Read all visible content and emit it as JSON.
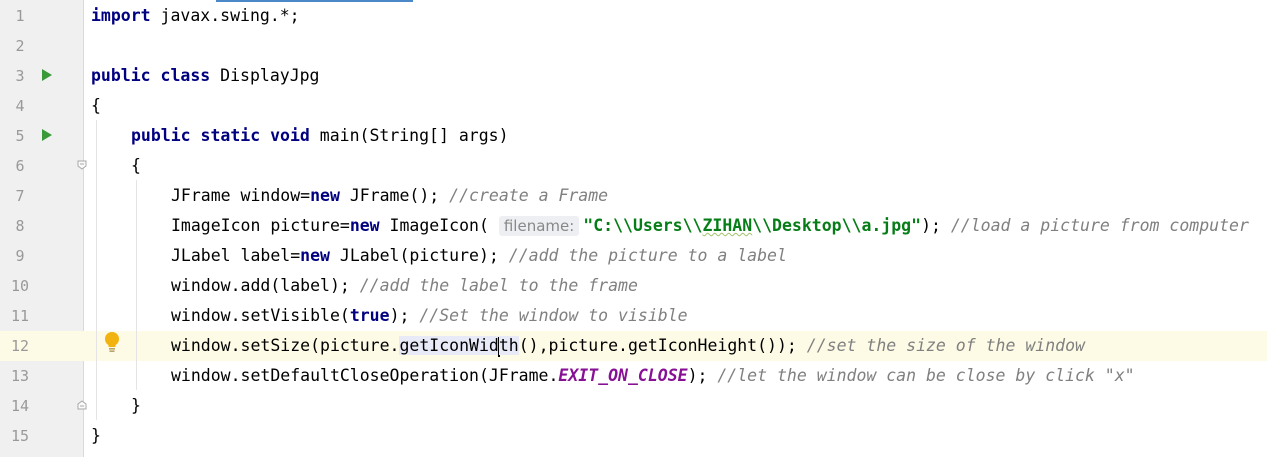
{
  "tokens": {
    "brace_open": "{",
    "brace_close": "}",
    "kw_import": "import",
    "import_rest": " javax.swing.*;",
    "kw_public": "public",
    "kw_class": "class",
    "class_name": " DisplayJpg",
    "kw_static": "static",
    "kw_void": "void",
    "main_sig": " main(String[] args)",
    "l7_a": "JFrame window=",
    "kw_new": "new",
    "l7_b": " JFrame(); ",
    "l7_c": "//create a Frame",
    "l8_a": "ImageIcon picture=",
    "l8_b": " ImageIcon(",
    "l8_hint": "filename:",
    "l8_str1": "\"C:\\\\Users\\\\",
    "l8_str_warn": "ZIHAN",
    "l8_str2": "\\\\Desktop\\\\a.jpg\"",
    "l8_d": "); ",
    "l8_e": "//load a picture from computer",
    "l9_a": "JLabel label=",
    "l9_b": " JLabel(picture); ",
    "l9_c": "//add the picture to a label",
    "l10_a": "window.add(label); ",
    "l10_b": "//add the label to the frame",
    "l11_a": "window.setVisible(",
    "kw_true": "true",
    "l11_b": "); ",
    "l11_c": "//Set the window to visible",
    "l12_a": "window.setSize(picture.",
    "l12_sel1": "getIconWid",
    "l12_sel2": "th",
    "l12_b": "(),picture.getIconHeight()); ",
    "l12_c": "//set the size of the window",
    "l13_a": "window.setDefaultCloseOperation(JFrame.",
    "l13_const": "EXIT_ON_CLOSE",
    "l13_b": "); ",
    "l13_c": "//let the window can be close by click \"x\""
  },
  "line_numbers": [
    "1",
    "2",
    "3",
    "4",
    "5",
    "6",
    "7",
    "8",
    "9",
    "10",
    "11",
    "12",
    "13",
    "14",
    "15"
  ],
  "colors": {
    "keyword": "#000080",
    "comment": "#808080",
    "string": "#067d17",
    "constant": "#871094",
    "current_line": "#fdfbe6",
    "run_icon": "#3a9a3a",
    "bulb_icon": "#f2b20f"
  },
  "icons": {
    "run": "run-icon",
    "fold": "fold-icon",
    "bulb": "lightbulb-icon"
  }
}
